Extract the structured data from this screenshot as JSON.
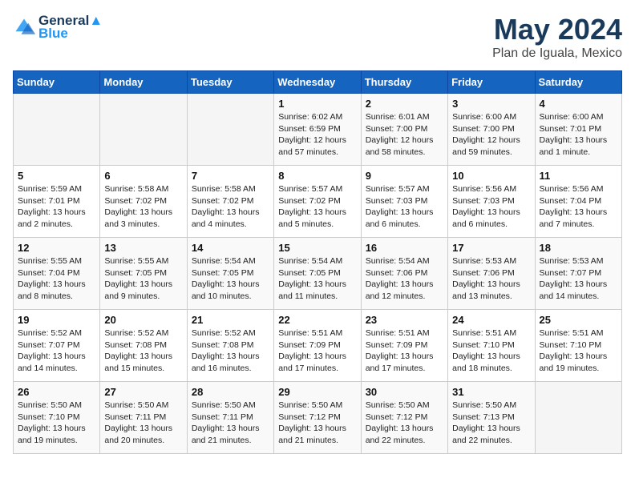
{
  "header": {
    "logo_line1": "General",
    "logo_line2": "Blue",
    "month_title": "May 2024",
    "location": "Plan de Iguala, Mexico"
  },
  "weekdays": [
    "Sunday",
    "Monday",
    "Tuesday",
    "Wednesday",
    "Thursday",
    "Friday",
    "Saturday"
  ],
  "weeks": [
    [
      {
        "day": "",
        "info": ""
      },
      {
        "day": "",
        "info": ""
      },
      {
        "day": "",
        "info": ""
      },
      {
        "day": "1",
        "info": "Sunrise: 6:02 AM\nSunset: 6:59 PM\nDaylight: 12 hours\nand 57 minutes."
      },
      {
        "day": "2",
        "info": "Sunrise: 6:01 AM\nSunset: 7:00 PM\nDaylight: 12 hours\nand 58 minutes."
      },
      {
        "day": "3",
        "info": "Sunrise: 6:00 AM\nSunset: 7:00 PM\nDaylight: 12 hours\nand 59 minutes."
      },
      {
        "day": "4",
        "info": "Sunrise: 6:00 AM\nSunset: 7:01 PM\nDaylight: 13 hours\nand 1 minute."
      }
    ],
    [
      {
        "day": "5",
        "info": "Sunrise: 5:59 AM\nSunset: 7:01 PM\nDaylight: 13 hours\nand 2 minutes."
      },
      {
        "day": "6",
        "info": "Sunrise: 5:58 AM\nSunset: 7:02 PM\nDaylight: 13 hours\nand 3 minutes."
      },
      {
        "day": "7",
        "info": "Sunrise: 5:58 AM\nSunset: 7:02 PM\nDaylight: 13 hours\nand 4 minutes."
      },
      {
        "day": "8",
        "info": "Sunrise: 5:57 AM\nSunset: 7:02 PM\nDaylight: 13 hours\nand 5 minutes."
      },
      {
        "day": "9",
        "info": "Sunrise: 5:57 AM\nSunset: 7:03 PM\nDaylight: 13 hours\nand 6 minutes."
      },
      {
        "day": "10",
        "info": "Sunrise: 5:56 AM\nSunset: 7:03 PM\nDaylight: 13 hours\nand 6 minutes."
      },
      {
        "day": "11",
        "info": "Sunrise: 5:56 AM\nSunset: 7:04 PM\nDaylight: 13 hours\nand 7 minutes."
      }
    ],
    [
      {
        "day": "12",
        "info": "Sunrise: 5:55 AM\nSunset: 7:04 PM\nDaylight: 13 hours\nand 8 minutes."
      },
      {
        "day": "13",
        "info": "Sunrise: 5:55 AM\nSunset: 7:05 PM\nDaylight: 13 hours\nand 9 minutes."
      },
      {
        "day": "14",
        "info": "Sunrise: 5:54 AM\nSunset: 7:05 PM\nDaylight: 13 hours\nand 10 minutes."
      },
      {
        "day": "15",
        "info": "Sunrise: 5:54 AM\nSunset: 7:05 PM\nDaylight: 13 hours\nand 11 minutes."
      },
      {
        "day": "16",
        "info": "Sunrise: 5:54 AM\nSunset: 7:06 PM\nDaylight: 13 hours\nand 12 minutes."
      },
      {
        "day": "17",
        "info": "Sunrise: 5:53 AM\nSunset: 7:06 PM\nDaylight: 13 hours\nand 13 minutes."
      },
      {
        "day": "18",
        "info": "Sunrise: 5:53 AM\nSunset: 7:07 PM\nDaylight: 13 hours\nand 14 minutes."
      }
    ],
    [
      {
        "day": "19",
        "info": "Sunrise: 5:52 AM\nSunset: 7:07 PM\nDaylight: 13 hours\nand 14 minutes."
      },
      {
        "day": "20",
        "info": "Sunrise: 5:52 AM\nSunset: 7:08 PM\nDaylight: 13 hours\nand 15 minutes."
      },
      {
        "day": "21",
        "info": "Sunrise: 5:52 AM\nSunset: 7:08 PM\nDaylight: 13 hours\nand 16 minutes."
      },
      {
        "day": "22",
        "info": "Sunrise: 5:51 AM\nSunset: 7:09 PM\nDaylight: 13 hours\nand 17 minutes."
      },
      {
        "day": "23",
        "info": "Sunrise: 5:51 AM\nSunset: 7:09 PM\nDaylight: 13 hours\nand 17 minutes."
      },
      {
        "day": "24",
        "info": "Sunrise: 5:51 AM\nSunset: 7:10 PM\nDaylight: 13 hours\nand 18 minutes."
      },
      {
        "day": "25",
        "info": "Sunrise: 5:51 AM\nSunset: 7:10 PM\nDaylight: 13 hours\nand 19 minutes."
      }
    ],
    [
      {
        "day": "26",
        "info": "Sunrise: 5:50 AM\nSunset: 7:10 PM\nDaylight: 13 hours\nand 19 minutes."
      },
      {
        "day": "27",
        "info": "Sunrise: 5:50 AM\nSunset: 7:11 PM\nDaylight: 13 hours\nand 20 minutes."
      },
      {
        "day": "28",
        "info": "Sunrise: 5:50 AM\nSunset: 7:11 PM\nDaylight: 13 hours\nand 21 minutes."
      },
      {
        "day": "29",
        "info": "Sunrise: 5:50 AM\nSunset: 7:12 PM\nDaylight: 13 hours\nand 21 minutes."
      },
      {
        "day": "30",
        "info": "Sunrise: 5:50 AM\nSunset: 7:12 PM\nDaylight: 13 hours\nand 22 minutes."
      },
      {
        "day": "31",
        "info": "Sunrise: 5:50 AM\nSunset: 7:13 PM\nDaylight: 13 hours\nand 22 minutes."
      },
      {
        "day": "",
        "info": ""
      }
    ]
  ]
}
